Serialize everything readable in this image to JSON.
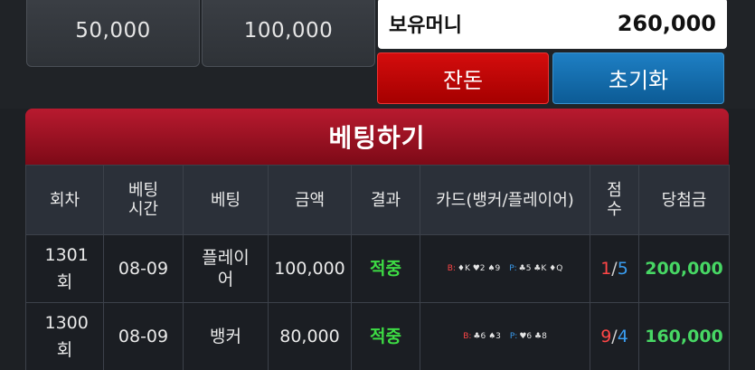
{
  "chips": [
    "50,000",
    "100,000"
  ],
  "money": {
    "label": "보유머니",
    "value": "260,000"
  },
  "buttons": {
    "change": "잔돈",
    "reset": "초기화"
  },
  "bet_title": "베팅하기",
  "table": {
    "headers": [
      "회차",
      "베팅시간",
      "베팅",
      "금액",
      "결과",
      "카드(뱅커/플레이어)",
      "점수",
      "당첨금"
    ],
    "rows": [
      {
        "round": "1301회",
        "time": "08-09",
        "bet": "플레이어",
        "amount": "100,000",
        "result": "적중",
        "banker_tag": "B:",
        "banker_cards": "♦K ♥2 ♠9",
        "player_tag": "P:",
        "player_cards": "♣5 ♣K ♦Q",
        "score_banker": "1",
        "score_player": "5",
        "payout": "200,000"
      },
      {
        "round": "1300회",
        "time": "08-09",
        "bet": "뱅커",
        "amount": "80,000",
        "result": "적중",
        "banker_tag": "B:",
        "banker_cards": "♣6 ♠3",
        "player_tag": "P:",
        "player_cards": "♥6 ♣8",
        "score_banker": "9",
        "score_player": "4",
        "payout": "160,000"
      }
    ]
  }
}
